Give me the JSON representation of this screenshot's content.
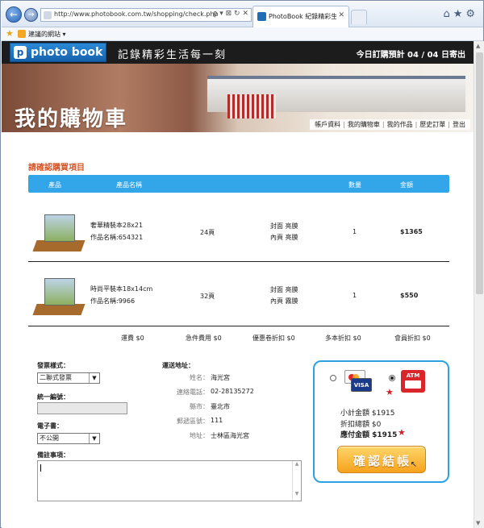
{
  "browser": {
    "url": "http://www.photobook.com.tw/shopping/check.php",
    "tab_title": "PhotoBook 紀錄精彩生活...",
    "favorites_label": "建議的網站 ▾",
    "addr_controls": "ρ ▾ ⊠ ↻ ✕",
    "tab_close": "✕",
    "right_icons": "⌂★⚙",
    "back_glyph": "←",
    "forward_glyph": "→"
  },
  "header": {
    "logo_mark": "p",
    "logo_text": "photo book",
    "slogan": "記錄精彩生活每一刻",
    "ship_notice": "今日訂購預計 04 / 04 日寄出",
    "page_title": "我的購物車",
    "nav": [
      "帳戶資料",
      "我的購物車",
      "我的作品",
      "歷史訂單",
      "登出"
    ],
    "nav_sep": "|"
  },
  "cart": {
    "section_title": "請確認購買項目",
    "columns": {
      "product": "產品",
      "name": "產品名稱",
      "qty": "數量",
      "amount": "金額"
    },
    "items": [
      {
        "name": "奢華精裝本28x21",
        "work": "作品名稱:654321",
        "pages": "24頁",
        "cover": "封面 亮膜",
        "inner": "內頁 亮膜",
        "qty": "1",
        "amount": "$1365"
      },
      {
        "name": "時尚平裝本18x14cm",
        "work": "作品名稱:9966",
        "pages": "32頁",
        "cover": "封面 亮膜",
        "inner": "內頁 霧膜",
        "qty": "1",
        "amount": "$550"
      }
    ],
    "fees": {
      "shipping": "運費 $0",
      "rush": "急件費用 $0",
      "coupon": "優惠卷折扣 $0",
      "multi": "多本折扣 $0",
      "member": "會員折扣 $0"
    }
  },
  "form": {
    "invoice_label": "發票樣式：",
    "invoice_value": "二聯式發票",
    "tax_id_label": "統一編號：",
    "ebook_label": "電子書：",
    "ebook_value": "不公開",
    "note_label": "備註事項：",
    "select_arrow": "▼",
    "scroll_glyphs": {
      "up": "▲",
      "down": "▼"
    }
  },
  "shipping": {
    "title": "運送地址：",
    "fields": [
      {
        "k": "姓名：",
        "v": "海光宮"
      },
      {
        "k": "連絡電話：",
        "v": "02-28135272"
      },
      {
        "k": "縣市：",
        "v": "臺北市"
      },
      {
        "k": "郵遞區號：",
        "v": "111"
      },
      {
        "k": "地址：",
        "v": "士林區海光宮"
      }
    ]
  },
  "payment": {
    "visa_text": "VISA",
    "atm_label": "ATM",
    "star_glyph": "★",
    "subtotal": "小計金額 $1915",
    "discount": "折扣總額 $0",
    "payable": "應付金額 $1915",
    "confirm_label": "確認結帳",
    "cursor_glyph": "↖",
    "selected": "atm"
  },
  "colors": {
    "accent": "#32a6e9",
    "section_title": "#d2572a",
    "button": "#f6a21c"
  }
}
